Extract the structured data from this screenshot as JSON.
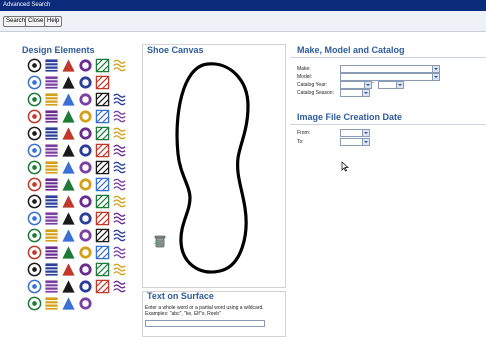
{
  "window": {
    "title": "Advanced Search"
  },
  "toolbar": {
    "search_label": "Search",
    "close_label": "Close",
    "help_label": "Help"
  },
  "design_elements": {
    "title": "Design Elements",
    "icons": [
      "circle-d-icon",
      "spiral-icon",
      "swirl-icon",
      "bullseye-icon",
      "target-icon",
      "question-mark-icon",
      "gear-sun-icon",
      "stripes-icon",
      "shield-icon",
      "u-letter-icon",
      "ring-icon",
      "blank-icon",
      "building-icon",
      "rainbow-arc-icon",
      "crescent-icon",
      "circle-c-icon",
      "circle-ring-icon",
      "circle-a-icon",
      "circle-c2-icon",
      "circle-i-icon",
      "ring-arc-icon",
      "ring-fill-icon",
      "spiral-red-icon",
      "ring-dot-icon",
      "waves-icon",
      "letter-l-icon",
      "stairs-icon",
      "square-dark-icon",
      "rounded-square-icon",
      "zigzag-icon",
      "chevrons-icon",
      "star-flag-icon",
      "brick-red-icon",
      "brick-grid-icon",
      "dots-grid-icon",
      "diagonal-icon",
      "checker-icon",
      "square-outline-icon",
      "brick-wall-icon",
      "bars-icon",
      "plaid-icon",
      "wave-blue-icon",
      "plus-small-icon",
      "triangle-outline-icon",
      "circle-s-icon",
      "circle-a2-icon",
      "square-grid-icon",
      "lines-icon",
      "stripes-horizontal-icon",
      "stripes-diagonal-icon",
      "text-logo-icon",
      "spade-red-icon",
      "house-icon",
      "grid-small-icon",
      "arrow-box-icon",
      "arrow-hook-icon",
      "plus-yellow-icon",
      "grid-color-icon",
      "tools-icon",
      "x-mark-icon",
      "helmet-icon",
      "dome-icon",
      "person-icon",
      "text-label-icon",
      "oval-icon",
      "mesh-icon",
      "crown-icon",
      "oval-purple-icon",
      "drop-green-icon",
      "bottle-icon",
      "d-letter-icon",
      "numeral-icon",
      "star-purple-icon",
      "script-text-icon",
      "circle-b-icon",
      "logo-text-icon",
      "stacked-text-icon",
      "cross-stack-icon",
      "logo-blue-icon",
      "logo-block-icon",
      "logo-outline-icon",
      "logo-swirl-icon",
      "logo-box-icon",
      "logo-dark-icon",
      "circle-r-icon",
      "chevron-stack-icon",
      "logo-badge-icon",
      "no-sign-icon",
      "blank-icon",
      "blank-icon"
    ]
  },
  "shoe_canvas": {
    "title": "Shoe Canvas"
  },
  "make_model": {
    "title": "Make, Model and Catalog",
    "make_label": "Make:",
    "model_label": "Model:",
    "catalog_year_label": "Catalog Year:",
    "catalog_season_label": "Catalog Season:",
    "year_separator": "-"
  },
  "image_date": {
    "title": "Image File Creation Date",
    "from_label": "From:",
    "to_label": "To:"
  },
  "text_surface": {
    "title": "Text on Surface",
    "instructions": "Enter a whole word or a partial word using a wildcard.",
    "examples": "Examples: \"abc\", \"ke, Elf\"o, Reeb\"",
    "input_value": ""
  },
  "colors": {
    "title_bar": "#0c2a7a",
    "heading": "#2f5c9c",
    "canvas_border": "#d3d3d3"
  }
}
